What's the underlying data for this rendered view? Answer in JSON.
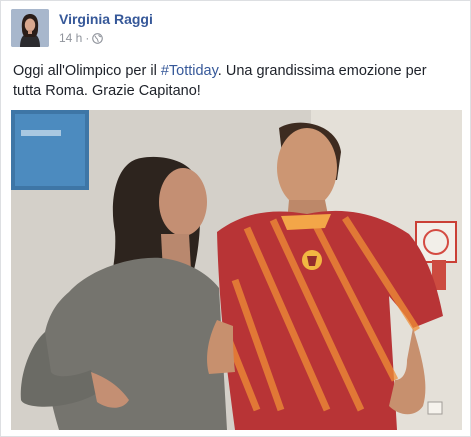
{
  "post": {
    "author": "Virginia Raggi",
    "time": "14 h",
    "separator": "·",
    "text_before": "Oggi all'Olimpico per il ",
    "hashtag": "#Tottiday",
    "text_after": ". Una grandissima emozione per tutta Roma. Grazie Capitano!",
    "privacy_icon": "globe-icon",
    "photo_description": "photo"
  },
  "colors": {
    "link": "#365899",
    "meta": "#90949c",
    "text": "#1d2129",
    "jersey": "#b3282d",
    "stripe": "#f08a2e"
  }
}
